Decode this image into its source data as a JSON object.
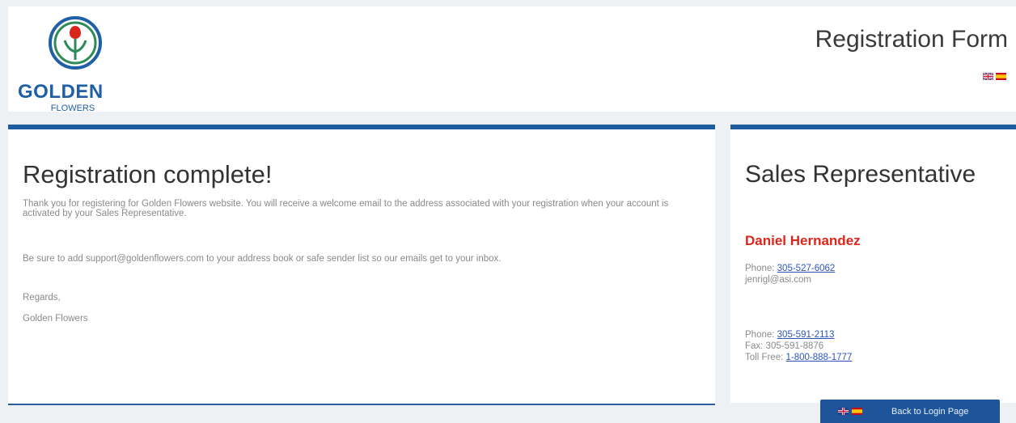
{
  "header": {
    "logo": {
      "word": "GOLDEN",
      "sub": "FLOWERS"
    },
    "title": "Registration Form",
    "flags": [
      "uk-flag",
      "spain-flag"
    ]
  },
  "main": {
    "title": "Registration complete!",
    "paragraph1": "Thank you for registering for Golden Flowers website. You will receive a welcome email to the address associated with your registration when your account is activated by your Sales Representative.",
    "paragraph2": "Be sure to add support@goldenflowers.com to your address book or safe sender list so our emails get to your inbox.",
    "regards": "Regards,",
    "signature": "Golden Flowers"
  },
  "sidebar": {
    "title": "Sales Representative",
    "rep_name": "Daniel Hernandez",
    "rep_phone_label": "Phone:",
    "rep_phone": "305-527-6062",
    "rep_email": "jenrigl@asi.com",
    "office_phone_label": "Phone:",
    "office_phone": "305-591-2113",
    "office_fax": "Fax: 305-591-8876",
    "office_tollfree_label": "Toll Free:",
    "office_tollfree": "1-800-888-1777"
  },
  "footer": {
    "back_link": "Back to Login Page"
  },
  "colors": {
    "accent": "#1e5ca0",
    "rep_name": "#d9261c",
    "link": "#2d55b9"
  }
}
